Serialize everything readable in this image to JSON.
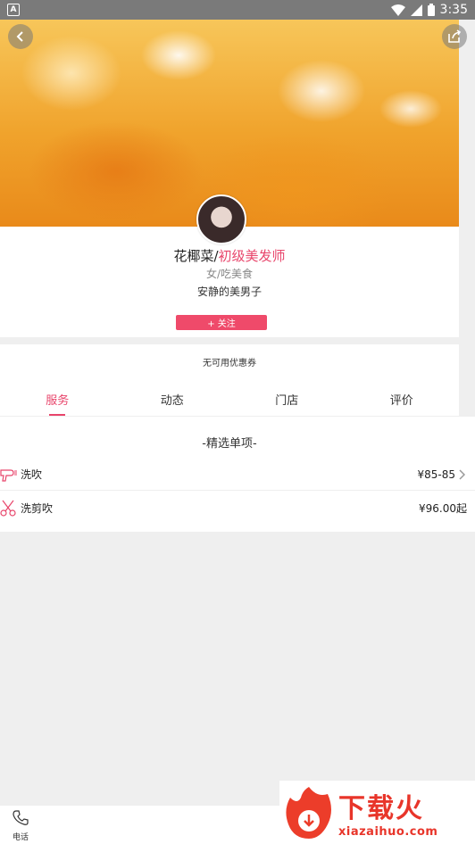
{
  "status_bar": {
    "left_icon": "A",
    "time": "3:35",
    "icons": [
      "wifi-icon",
      "signal-icon",
      "battery-icon"
    ]
  },
  "hero": {
    "back_icon": "back-arrow-icon",
    "share_icon": "share-icon"
  },
  "profile": {
    "name": "花椰菜/",
    "role": "初级美发师",
    "gender_tags": "女/吃美食",
    "bio": "安静的美男子",
    "follow_label": "+ 关注"
  },
  "coupon": {
    "text": "无可用优惠券"
  },
  "tabs": [
    {
      "label": "服务",
      "active": true
    },
    {
      "label": "动态",
      "active": false
    },
    {
      "label": "门店",
      "active": false
    },
    {
      "label": "评价",
      "active": false
    }
  ],
  "services": {
    "title": "-精选单项-",
    "items": [
      {
        "name": "洗吹",
        "price": "¥85-85",
        "icon": "hair-dryer-icon"
      },
      {
        "name": "洗剪吹",
        "price": "¥96.00起",
        "icon": "scissors-icon"
      }
    ]
  },
  "bottom": {
    "phone_label": "电话"
  },
  "watermark": {
    "title": "下载火",
    "url": "xiazaihuo.com"
  },
  "colors": {
    "accent": "#e8456b",
    "status_bar": "#7a7a7a",
    "watermark": "#e8352a"
  }
}
